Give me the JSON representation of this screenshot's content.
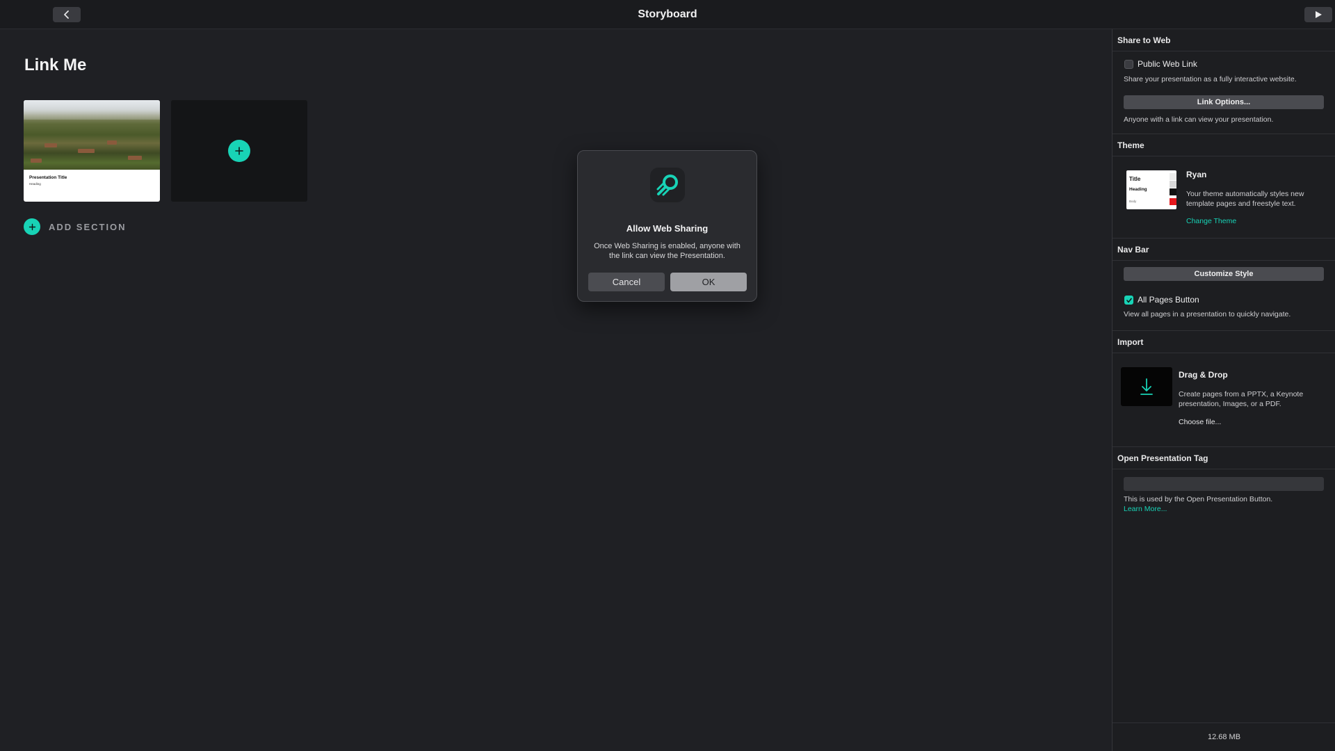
{
  "topbar": {
    "title": "Storyboard"
  },
  "main": {
    "page_title": "Link Me",
    "thumbnail": {
      "title": "Presentation Title",
      "subtitle": "Heading"
    },
    "add_section_label": "ADD SECTION"
  },
  "modal": {
    "title": "Allow Web Sharing",
    "body": "Once Web Sharing is enabled, anyone with the link can view the Presentation.",
    "cancel_label": "Cancel",
    "ok_label": "OK"
  },
  "panel": {
    "share": {
      "header": "Share to Web",
      "public_link_label": "Public Web Link",
      "public_link_checked": false,
      "description": "Share your presentation as a fully interactive website.",
      "link_options_label": "Link Options...",
      "note": "Anyone with a link can view your presentation."
    },
    "theme": {
      "header": "Theme",
      "name": "Ryan",
      "description": "Your theme automatically styles new template pages and freestyle text.",
      "change_label": "Change Theme",
      "preview": {
        "title": "Title",
        "heading": "Heading",
        "body": "Body"
      }
    },
    "navbar": {
      "header": "Nav Bar",
      "customize_label": "Customize Style",
      "all_pages_label": "All Pages Button",
      "all_pages_checked": true,
      "description": "View all pages in a presentation to quickly navigate."
    },
    "import": {
      "header": "Import",
      "title": "Drag & Drop",
      "description": "Create pages from a PPTX, a Keynote presentation, Images, or a PDF.",
      "choose_label": "Choose file..."
    },
    "tag": {
      "header": "Open Presentation Tag",
      "value": "",
      "description": "This is used by the Open Presentation Button.",
      "learn_more": "Learn More..."
    },
    "footer_size": "12.68 MB"
  },
  "colors": {
    "accent": "#18d3b6",
    "background": "#1f2024",
    "panel": "#1d1e21"
  },
  "icons": [
    "chevron-left-icon",
    "play-icon",
    "plus-icon",
    "rocket-icon",
    "checkmark-icon",
    "download-icon"
  ]
}
